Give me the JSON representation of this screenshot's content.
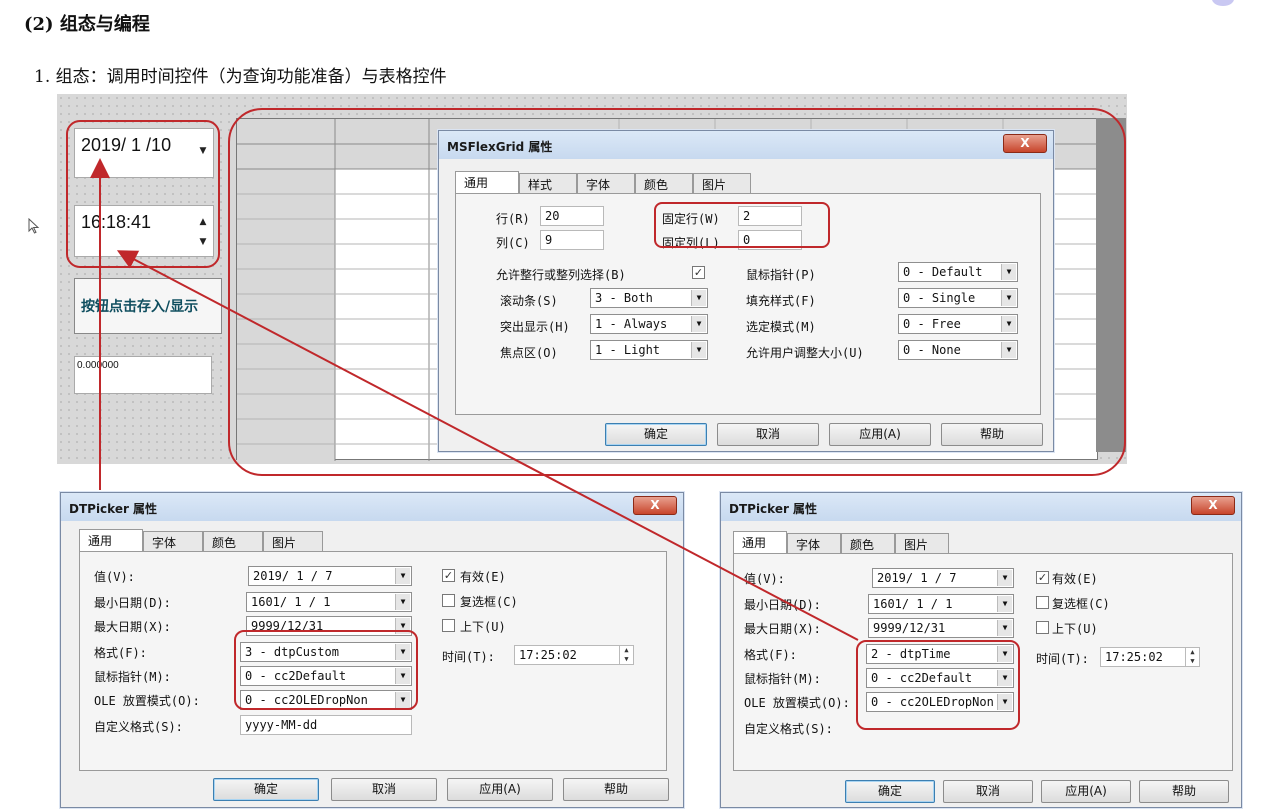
{
  "doc": {
    "section_heading": "(2) 组态与编程",
    "step_heading": "1. 组态：调用时间控件（为查询功能准备）与表格控件"
  },
  "form": {
    "date_value": "2019/ 1 /10",
    "time_value": "16:18:41",
    "button_label": "按钮点击存入/显示",
    "text_value": "0.000000"
  },
  "flexgrid_dialog": {
    "title": "MSFlexGrid 属性",
    "close_label": "X",
    "tabs": [
      "通用",
      "样式",
      "字体",
      "颜色",
      "图片"
    ],
    "rows_label": "行(R)",
    "rows_value": "20",
    "cols_label": "列(C)",
    "cols_value": "9",
    "fixed_rows_label": "固定行(W)",
    "fixed_rows_value": "2",
    "fixed_cols_label": "固定列(L)",
    "fixed_cols_value": "0",
    "allow_select_label": "允许整行或整列选择(B)",
    "allow_select_check": "✓",
    "left_rows": [
      {
        "label": "滚动条(S)",
        "value": "3 - Both"
      },
      {
        "label": "突出显示(H)",
        "value": "1 - Always"
      },
      {
        "label": "焦点区(O)",
        "value": "1 - Light"
      }
    ],
    "right_rows": [
      {
        "label": "鼠标指针(P)",
        "value": "0 - Default"
      },
      {
        "label": "填充样式(F)",
        "value": "0 - Single"
      },
      {
        "label": "选定模式(M)",
        "value": "0 - Free"
      },
      {
        "label": "允许用户调整大小(U)",
        "value": "0 - None"
      }
    ],
    "buttons": [
      "确定",
      "取消",
      "应用(A)",
      "帮助"
    ]
  },
  "dtp_left": {
    "title": "DTPicker 属性",
    "close_label": "X",
    "tabs": [
      "通用",
      "字体",
      "颜色",
      "图片"
    ],
    "value_label": "值(V):",
    "value": "2019/ 1 / 7",
    "min_label": "最小日期(D):",
    "min": "1601/ 1 / 1",
    "max_label": "最大日期(X):",
    "max": "9999/12/31",
    "format_label": "格式(F):",
    "format": "3 - dtpCustom",
    "mouse_label": "鼠标指针(M):",
    "mouse": "0 - cc2Default",
    "ole_label": "OLE 放置模式(O):",
    "ole": "0 - cc2OLEDropNon",
    "custom_label": "自定义格式(S):",
    "custom": "yyyy-MM-dd",
    "enabled_label": "有效(E)",
    "enabled_check": "✓",
    "checkbox_label": "复选框(C)",
    "updown_label": "上下(U)",
    "time_label": "时间(T):",
    "time": "17:25:02",
    "buttons": [
      "确定",
      "取消",
      "应用(A)",
      "帮助"
    ]
  },
  "dtp_right": {
    "title": "DTPicker 属性",
    "close_label": "X",
    "tabs": [
      "通用",
      "字体",
      "颜色",
      "图片"
    ],
    "value_label": "值(V):",
    "value": "2019/ 1 / 7",
    "min_label": "最小日期(D):",
    "min": "1601/ 1 / 1",
    "max_label": "最大日期(X):",
    "max": "9999/12/31",
    "format_label": "格式(F):",
    "format": "2 - dtpTime",
    "mouse_label": "鼠标指针(M):",
    "mouse": "0 - cc2Default",
    "ole_label": "OLE 放置模式(O):",
    "ole": "0 - cc2OLEDropNon",
    "custom_label": "自定义格式(S):",
    "enabled_label": "有效(E)",
    "enabled_check": "✓",
    "checkbox_label": "复选框(C)",
    "updown_label": "上下(U)",
    "time_label": "时间(T):",
    "time": "17:25:02",
    "buttons": [
      "确定",
      "取消",
      "应用(A)",
      "帮助"
    ]
  },
  "icons": {
    "dropdown": "▼",
    "spin_up": "▲",
    "spin_down": "▼"
  },
  "colors": {
    "annotation_red": "#c0282b",
    "button_text": "#0f4e5f"
  }
}
